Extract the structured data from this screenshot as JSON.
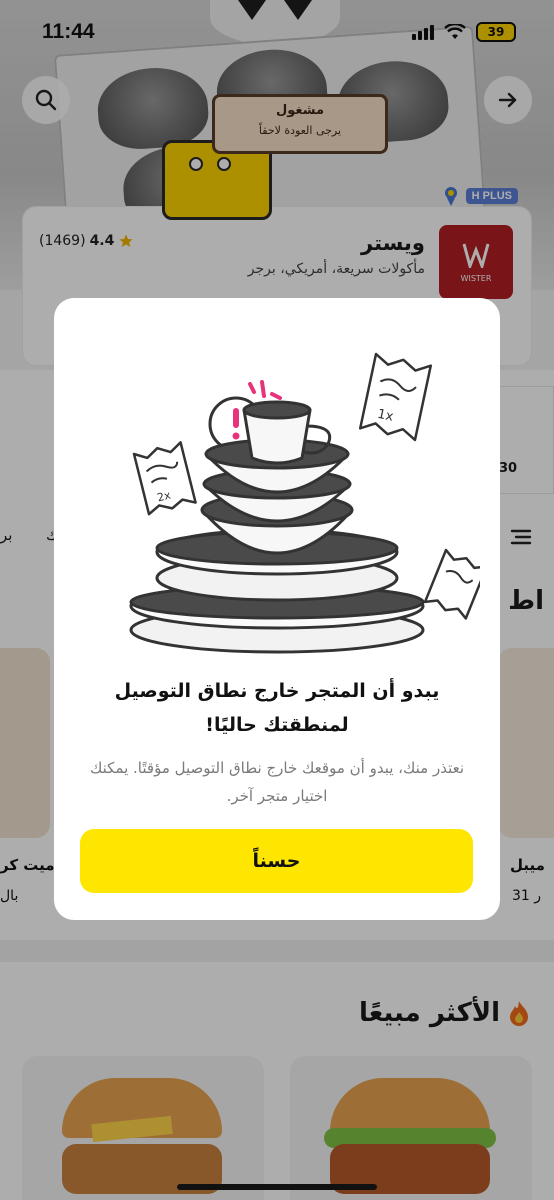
{
  "status_bar": {
    "time": "11:44",
    "battery": "39"
  },
  "store": {
    "busy_title": "مشغول",
    "busy_subtitle": "يرجى العودة لاحقاً",
    "badge_plus": "PLUS",
    "badge_h": "H",
    "logo_text": "WISTER",
    "name": "ويستر",
    "categories": "مأكولات سريعة، أمريكي، برجر",
    "rating": "4.4",
    "review_count": "(1469)"
  },
  "background": {
    "side_value": "30",
    "tab_partial_1": "بر",
    "tab_partial_2": "ك",
    "section_title_partial": "اط",
    "product_left_name_partial": "ميت كر",
    "product_left_price_partial": "بال",
    "product_right_name_partial": "ميبل",
    "product_right_price_partial": "31 ر",
    "best_sellers_title": "الأكثر مبيعًا"
  },
  "modal": {
    "title": "يبدو أن المتجر خارج نطاق التوصيل لمنطقتك حاليًا!",
    "subtitle": "نعتذر منك، يبدو أن موقعك خارج نطاق التوصيل مؤقتًا. يمكنك اختيار متجر آخر.",
    "ok_label": "حسناً",
    "receipt_big_text": "1x",
    "receipt_small_text": "2x"
  },
  "colors": {
    "accent_yellow": "#ffe600",
    "brand_red": "#b31f25",
    "alert_pink": "#e8327c"
  }
}
